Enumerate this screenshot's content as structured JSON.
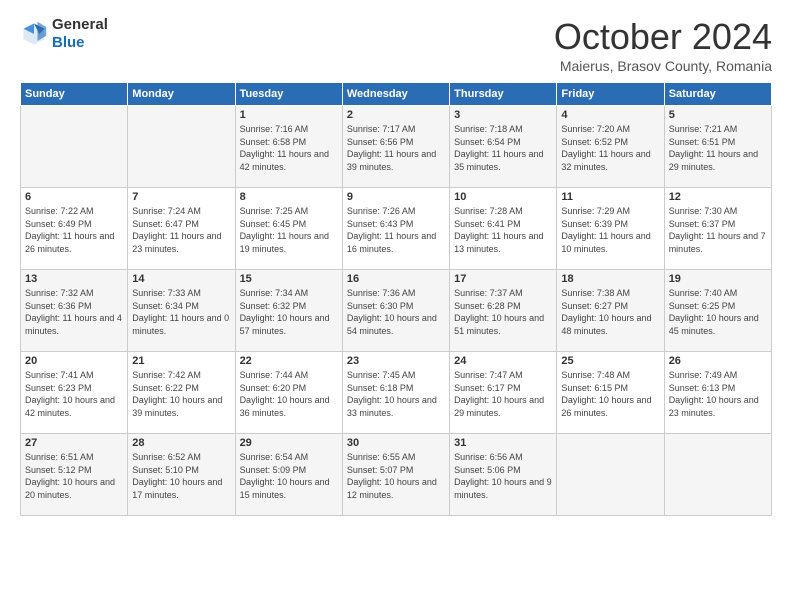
{
  "header": {
    "logo": {
      "line1": "General",
      "line2": "Blue"
    },
    "title": "October 2024",
    "subtitle": "Maierus, Brasov County, Romania"
  },
  "days_of_week": [
    "Sunday",
    "Monday",
    "Tuesday",
    "Wednesday",
    "Thursday",
    "Friday",
    "Saturday"
  ],
  "weeks": [
    [
      {
        "day": "",
        "info": ""
      },
      {
        "day": "",
        "info": ""
      },
      {
        "day": "1",
        "info": "Sunrise: 7:16 AM\nSunset: 6:58 PM\nDaylight: 11 hours and 42 minutes."
      },
      {
        "day": "2",
        "info": "Sunrise: 7:17 AM\nSunset: 6:56 PM\nDaylight: 11 hours and 39 minutes."
      },
      {
        "day": "3",
        "info": "Sunrise: 7:18 AM\nSunset: 6:54 PM\nDaylight: 11 hours and 35 minutes."
      },
      {
        "day": "4",
        "info": "Sunrise: 7:20 AM\nSunset: 6:52 PM\nDaylight: 11 hours and 32 minutes."
      },
      {
        "day": "5",
        "info": "Sunrise: 7:21 AM\nSunset: 6:51 PM\nDaylight: 11 hours and 29 minutes."
      }
    ],
    [
      {
        "day": "6",
        "info": "Sunrise: 7:22 AM\nSunset: 6:49 PM\nDaylight: 11 hours and 26 minutes."
      },
      {
        "day": "7",
        "info": "Sunrise: 7:24 AM\nSunset: 6:47 PM\nDaylight: 11 hours and 23 minutes."
      },
      {
        "day": "8",
        "info": "Sunrise: 7:25 AM\nSunset: 6:45 PM\nDaylight: 11 hours and 19 minutes."
      },
      {
        "day": "9",
        "info": "Sunrise: 7:26 AM\nSunset: 6:43 PM\nDaylight: 11 hours and 16 minutes."
      },
      {
        "day": "10",
        "info": "Sunrise: 7:28 AM\nSunset: 6:41 PM\nDaylight: 11 hours and 13 minutes."
      },
      {
        "day": "11",
        "info": "Sunrise: 7:29 AM\nSunset: 6:39 PM\nDaylight: 11 hours and 10 minutes."
      },
      {
        "day": "12",
        "info": "Sunrise: 7:30 AM\nSunset: 6:37 PM\nDaylight: 11 hours and 7 minutes."
      }
    ],
    [
      {
        "day": "13",
        "info": "Sunrise: 7:32 AM\nSunset: 6:36 PM\nDaylight: 11 hours and 4 minutes."
      },
      {
        "day": "14",
        "info": "Sunrise: 7:33 AM\nSunset: 6:34 PM\nDaylight: 11 hours and 0 minutes."
      },
      {
        "day": "15",
        "info": "Sunrise: 7:34 AM\nSunset: 6:32 PM\nDaylight: 10 hours and 57 minutes."
      },
      {
        "day": "16",
        "info": "Sunrise: 7:36 AM\nSunset: 6:30 PM\nDaylight: 10 hours and 54 minutes."
      },
      {
        "day": "17",
        "info": "Sunrise: 7:37 AM\nSunset: 6:28 PM\nDaylight: 10 hours and 51 minutes."
      },
      {
        "day": "18",
        "info": "Sunrise: 7:38 AM\nSunset: 6:27 PM\nDaylight: 10 hours and 48 minutes."
      },
      {
        "day": "19",
        "info": "Sunrise: 7:40 AM\nSunset: 6:25 PM\nDaylight: 10 hours and 45 minutes."
      }
    ],
    [
      {
        "day": "20",
        "info": "Sunrise: 7:41 AM\nSunset: 6:23 PM\nDaylight: 10 hours and 42 minutes."
      },
      {
        "day": "21",
        "info": "Sunrise: 7:42 AM\nSunset: 6:22 PM\nDaylight: 10 hours and 39 minutes."
      },
      {
        "day": "22",
        "info": "Sunrise: 7:44 AM\nSunset: 6:20 PM\nDaylight: 10 hours and 36 minutes."
      },
      {
        "day": "23",
        "info": "Sunrise: 7:45 AM\nSunset: 6:18 PM\nDaylight: 10 hours and 33 minutes."
      },
      {
        "day": "24",
        "info": "Sunrise: 7:47 AM\nSunset: 6:17 PM\nDaylight: 10 hours and 29 minutes."
      },
      {
        "day": "25",
        "info": "Sunrise: 7:48 AM\nSunset: 6:15 PM\nDaylight: 10 hours and 26 minutes."
      },
      {
        "day": "26",
        "info": "Sunrise: 7:49 AM\nSunset: 6:13 PM\nDaylight: 10 hours and 23 minutes."
      }
    ],
    [
      {
        "day": "27",
        "info": "Sunrise: 6:51 AM\nSunset: 5:12 PM\nDaylight: 10 hours and 20 minutes."
      },
      {
        "day": "28",
        "info": "Sunrise: 6:52 AM\nSunset: 5:10 PM\nDaylight: 10 hours and 17 minutes."
      },
      {
        "day": "29",
        "info": "Sunrise: 6:54 AM\nSunset: 5:09 PM\nDaylight: 10 hours and 15 minutes."
      },
      {
        "day": "30",
        "info": "Sunrise: 6:55 AM\nSunset: 5:07 PM\nDaylight: 10 hours and 12 minutes."
      },
      {
        "day": "31",
        "info": "Sunrise: 6:56 AM\nSunset: 5:06 PM\nDaylight: 10 hours and 9 minutes."
      },
      {
        "day": "",
        "info": ""
      },
      {
        "day": "",
        "info": ""
      }
    ]
  ]
}
